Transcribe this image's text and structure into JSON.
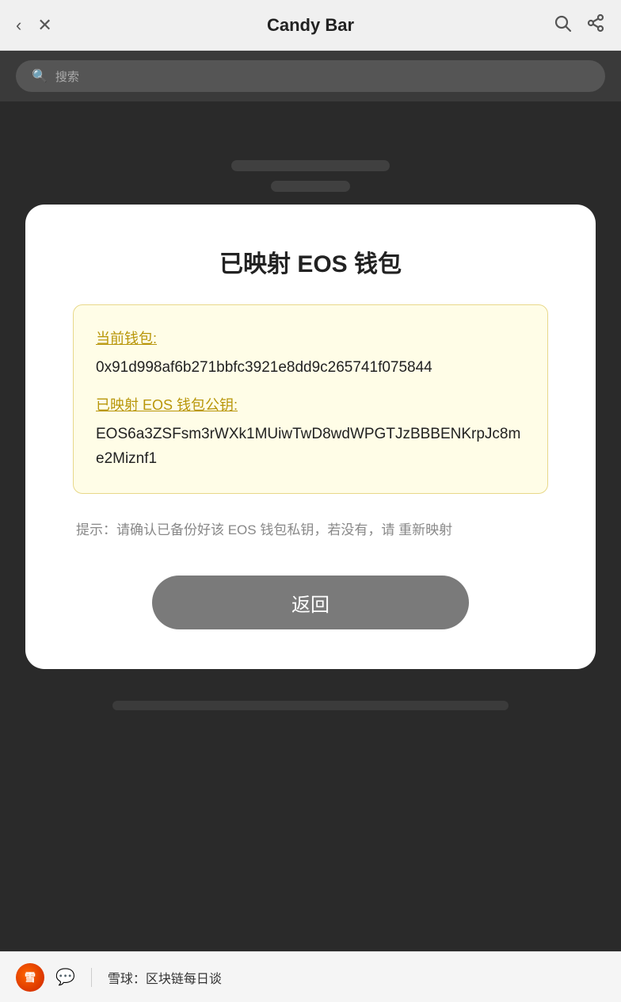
{
  "nav": {
    "title": "Candy Bar",
    "back_icon": "‹",
    "close_icon": "✕"
  },
  "search": {
    "placeholder": "搜索"
  },
  "card": {
    "title": "已映射 EOS 钱包",
    "current_wallet_label": "当前钱包:",
    "current_wallet_value": "0x91d998af6b271bbfc3921e8dd9c265741f075844",
    "eos_wallet_label": "已映射 EOS 钱包公钥:",
    "eos_wallet_value": "EOS6a3ZSFsm3rWXk1MUiwTwD8wdWPGTJzBBBENKrpJc8me2Miznf1",
    "hint_text": "提示：请确认已备份好该 EOS 钱包私钥，若没有，请 重新映射",
    "return_button_label": "返回"
  },
  "footer": {
    "logo_text": "雪",
    "site_name": "雪球：区块链每日谈",
    "wechat_icon": "💬"
  },
  "colors": {
    "info_box_bg": "#fffde7",
    "info_box_border": "#e8d88a",
    "info_label_color": "#b8960a",
    "return_btn_bg": "#7a7a7a",
    "dark_bg": "#2a2a2a"
  }
}
